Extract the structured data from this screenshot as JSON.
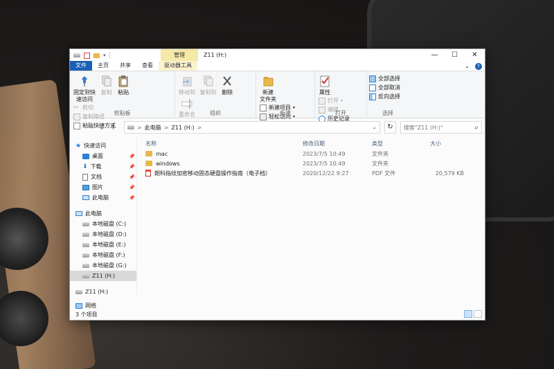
{
  "window": {
    "manage_tab": "管理",
    "title": "Z11 (H:)",
    "minimize": "—",
    "maximize": "☐",
    "close": "✕"
  },
  "tabs": {
    "file": "文件",
    "home": "主页",
    "share": "共享",
    "view": "查看",
    "drive_tools": "驱动器工具",
    "collapse": "⌄",
    "help": "?"
  },
  "ribbon": {
    "clipboard": {
      "label": "剪贴板",
      "pin": "固定到快\n速访问",
      "copy": "复制",
      "paste": "粘贴",
      "cut": "剪切",
      "copy_path": "复制路径",
      "paste_shortcut": "粘贴快捷方式"
    },
    "organize": {
      "label": "组织",
      "move_to": "移动到",
      "copy_to": "复制到",
      "delete": "删除",
      "rename": "重命名"
    },
    "new": {
      "label": "新建",
      "new_folder": "新建\n文件夹",
      "new_item": "新建项目",
      "easy_access": "轻松访问"
    },
    "open": {
      "label": "打开",
      "properties": "属性",
      "open": "打开",
      "edit": "编辑",
      "history": "历史记录"
    },
    "select": {
      "label": "选择",
      "select_all": "全部选择",
      "select_none": "全部取消",
      "invert": "反向选择"
    }
  },
  "address": {
    "back": "←",
    "forward": "→",
    "recent": "⌄",
    "up": "↑",
    "crumb_pc": "此电脑",
    "crumb_drive": "Z11 (H:)",
    "sep": ">",
    "refresh": "↻",
    "search_placeholder": "搜索\"Z11 (H:)\"",
    "search_icon": "⌕"
  },
  "nav": {
    "quick_access": "快速访问",
    "desktop": "桌面",
    "downloads": "下载",
    "documents": "文档",
    "pictures": "图片",
    "this_pc_quick": "此电脑",
    "this_pc": "此电脑",
    "drive_c": "本地磁盘 (C:)",
    "drive_d": "本地磁盘 (D:)",
    "drive_e": "本地磁盘 (E:)",
    "drive_f": "本地磁盘 (F:)",
    "drive_g": "本地磁盘 (G:)",
    "drive_h": "Z11 (H:)",
    "drive_h2": "Z11 (H:)",
    "network": "网络",
    "pin": "📌"
  },
  "columns": {
    "name": "名称",
    "modified": "修改日期",
    "type": "类型",
    "size": "大小"
  },
  "files": [
    {
      "name": "mac",
      "modified": "2023/7/5 10:49",
      "type": "文件夹",
      "size": ""
    },
    {
      "name": "windows",
      "modified": "2023/7/5 10:49",
      "type": "文件夹",
      "size": ""
    },
    {
      "name": "朗科指纹加密移动固态硬盘操作指南（电子档）",
      "modified": "2020/12/22 9:27",
      "type": "PDF 文件",
      "size": "20,579 KB"
    }
  ],
  "status": {
    "count": "3 个项目"
  }
}
